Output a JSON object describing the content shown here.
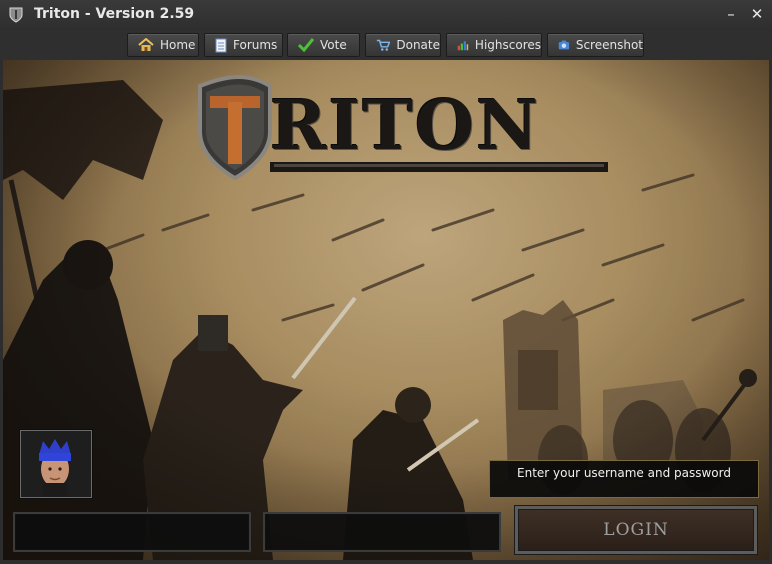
{
  "window": {
    "title": "Triton - Version 2.59",
    "minimize_label": "–",
    "close_label": "✕",
    "icon": "shield-icon"
  },
  "nav": [
    {
      "label": "Home",
      "icon": "home-icon"
    },
    {
      "label": "Forums",
      "icon": "document-icon"
    },
    {
      "label": "Vote",
      "icon": "checkmark-icon"
    },
    {
      "label": "Donate",
      "icon": "cart-icon"
    },
    {
      "label": "Highscores",
      "icon": "bar-chart-icon"
    },
    {
      "label": "Screenshot",
      "icon": "camera-icon"
    }
  ],
  "logo": {
    "text": "RITON",
    "letter": "T"
  },
  "login": {
    "message": "Enter your username and password",
    "username_value": "",
    "password_value": "",
    "button_label": "LOGIN"
  },
  "colors": {
    "titlebar_bg": "#2e2e2e",
    "login_button_bg": "#3a2c22",
    "message_border": "#7a6a3d"
  }
}
